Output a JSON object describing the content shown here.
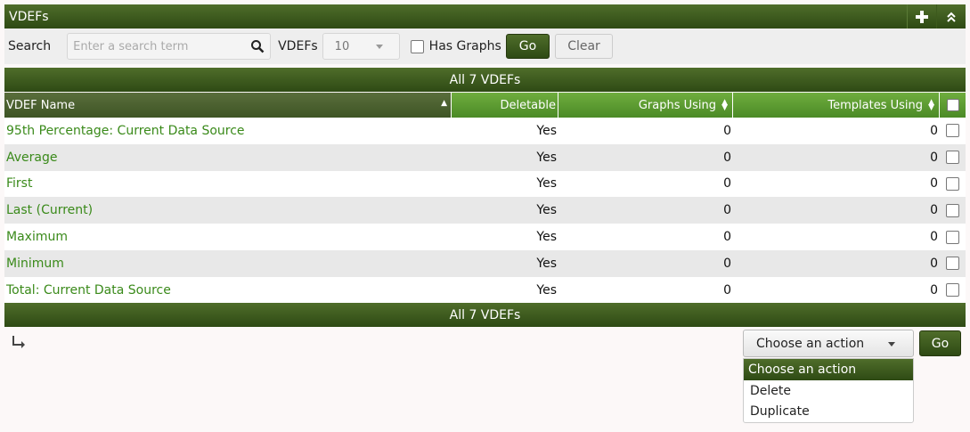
{
  "header": {
    "title": "VDEFs",
    "add_icon": "plus-icon",
    "collapse_icon": "double-chevron-up-icon"
  },
  "filter": {
    "search_label": "Search",
    "search_placeholder": "Enter a search term",
    "rows_label": "VDEFs",
    "rows_value": "10",
    "has_graphs_label": "Has Graphs",
    "go_label": "Go",
    "clear_label": "Clear"
  },
  "banner_text": "All 7 VDEFs",
  "columns": {
    "name": "VDEF Name",
    "deletable": "Deletable",
    "graphs_using": "Graphs Using",
    "templates_using": "Templates Using"
  },
  "rows": [
    {
      "name": "95th Percentage: Current Data Source",
      "deletable": "Yes",
      "graphs": "0",
      "templates": "0"
    },
    {
      "name": "Average",
      "deletable": "Yes",
      "graphs": "0",
      "templates": "0"
    },
    {
      "name": "First",
      "deletable": "Yes",
      "graphs": "0",
      "templates": "0"
    },
    {
      "name": "Last (Current)",
      "deletable": "Yes",
      "graphs": "0",
      "templates": "0"
    },
    {
      "name": "Maximum",
      "deletable": "Yes",
      "graphs": "0",
      "templates": "0"
    },
    {
      "name": "Minimum",
      "deletable": "Yes",
      "graphs": "0",
      "templates": "0"
    },
    {
      "name": "Total: Current Data Source",
      "deletable": "Yes",
      "graphs": "0",
      "templates": "0"
    }
  ],
  "actions": {
    "selected": "Choose an action",
    "go_label": "Go",
    "options": [
      "Choose an action",
      "Delete",
      "Duplicate"
    ]
  },
  "colors": {
    "brand_dark": "#2e4a14",
    "link": "#3a8a1a",
    "header_light": "#4b8a26"
  }
}
